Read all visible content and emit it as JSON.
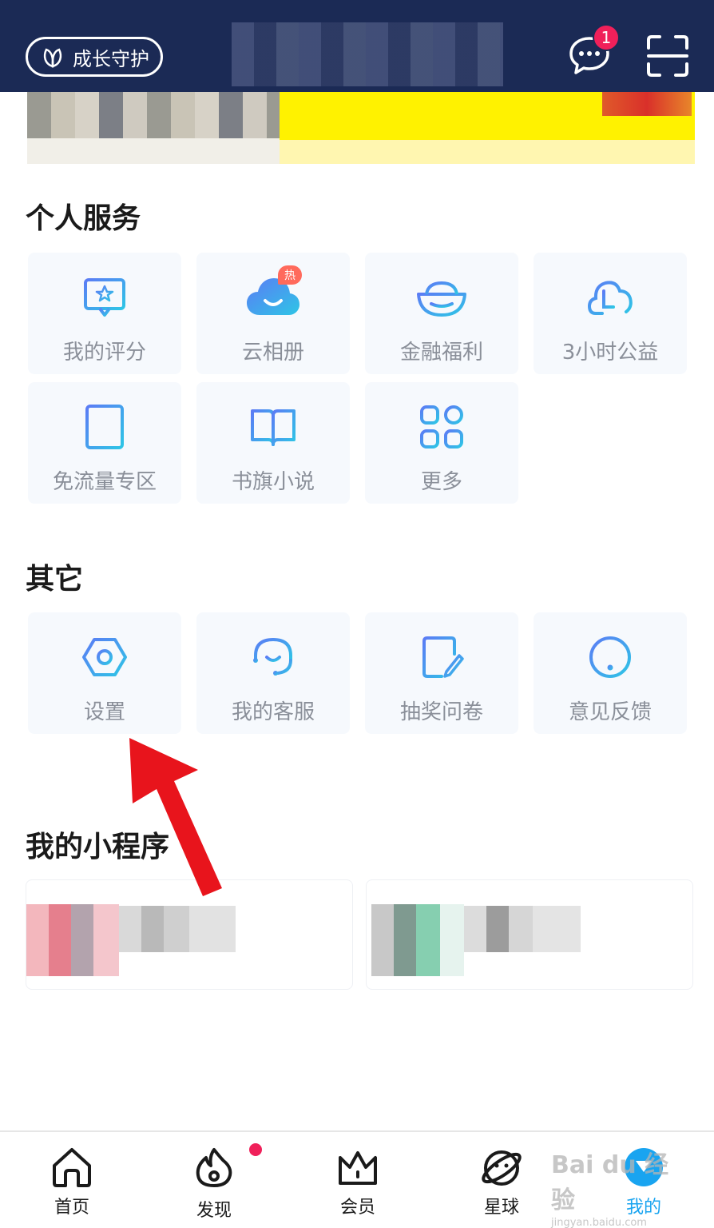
{
  "header": {
    "guard_label": "成长守护",
    "message_badge": "1"
  },
  "personal_services": {
    "title": "个人服务",
    "items": [
      {
        "label": "我的评分",
        "icon": "rating-icon"
      },
      {
        "label": "云相册",
        "icon": "cloud-album-icon",
        "badge": "热"
      },
      {
        "label": "金融福利",
        "icon": "gold-ingot-icon"
      },
      {
        "label": "3小时公益",
        "icon": "charity-icon"
      },
      {
        "label": "免流量专区",
        "icon": "data-free-icon"
      },
      {
        "label": "书旗小说",
        "icon": "book-icon"
      },
      {
        "label": "更多",
        "icon": "more-grid-icon"
      }
    ]
  },
  "others": {
    "title": "其它",
    "items": [
      {
        "label": "设置",
        "icon": "settings-icon"
      },
      {
        "label": "我的客服",
        "icon": "customer-service-icon"
      },
      {
        "label": "抽奖问卷",
        "icon": "survey-icon"
      },
      {
        "label": "意见反馈",
        "icon": "feedback-icon"
      }
    ]
  },
  "mini_programs": {
    "title": "我的小程序"
  },
  "tabbar": {
    "items": [
      {
        "label": "首页",
        "icon": "home-icon"
      },
      {
        "label": "发现",
        "icon": "discover-icon"
      },
      {
        "label": "会员",
        "icon": "crown-icon"
      },
      {
        "label": "星球",
        "icon": "planet-icon"
      },
      {
        "label": "我的",
        "icon": "profile-icon",
        "active": true
      }
    ]
  },
  "watermark": {
    "brand": "Bai du 经验",
    "url": "jingyan.baidu.com"
  },
  "colors": {
    "header_bg": "#1b2a55",
    "icon_gradient_start": "#5b7cf5",
    "icon_gradient_end": "#2ec5e6",
    "badge_red": "#f0205a",
    "active_tab": "#19a4f0",
    "arrow_red": "#e8141c"
  }
}
